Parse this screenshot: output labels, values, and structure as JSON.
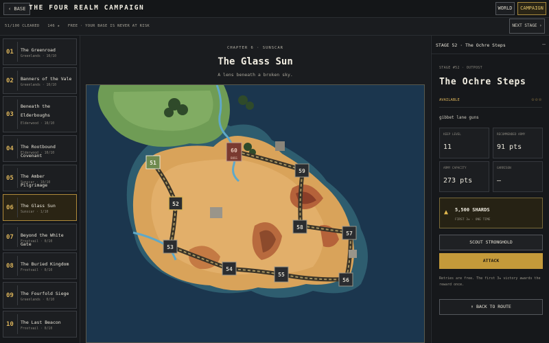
{
  "header": {
    "back_label": "‹ BASE",
    "title": "THE FOUR REALM CAMPAIGN",
    "world_label": "WORLD",
    "campaign_label": "CAMPAIGN"
  },
  "status": {
    "cleared": "51/100 CLEARED",
    "stars": "146 ★",
    "note": "FREE · YOUR BASE IS NEVER AT RISK",
    "next_label": "NEXT STAGE ›"
  },
  "stages": [
    {
      "num": "01",
      "name": "The Greenroad",
      "meta": "Greenlands · 10/10"
    },
    {
      "num": "02",
      "name": "Banners of the Vale",
      "meta": "Greenlands · 10/10"
    },
    {
      "num": "03",
      "name": "Beneath the Elderboughs",
      "meta": "Elderwood · 10/10"
    },
    {
      "num": "04",
      "name": "The Rootbound Covenant",
      "meta": "Elderwood · 10/10"
    },
    {
      "num": "05",
      "name": "The Amber Pilgrimage",
      "meta": "Sunscar · 10/10"
    },
    {
      "num": "06",
      "name": "The Glass Sun",
      "meta": "Sunscar · 1/10"
    },
    {
      "num": "07",
      "name": "Beyond the White Gate",
      "meta": "Frostvail · 0/10"
    },
    {
      "num": "08",
      "name": "The Buried Kingdom",
      "meta": "Frostvail · 0/10"
    },
    {
      "num": "09",
      "name": "The Fourfold Siege",
      "meta": "Greenlands · 0/10"
    },
    {
      "num": "10",
      "name": "The Last Beacon",
      "meta": "Frostvail · 0/10"
    }
  ],
  "center": {
    "chapter": "CHAPTER 6 · SUNSCAR",
    "title": "The Glass Sun",
    "subtitle": "A lens beneath a broken sky."
  },
  "map": {
    "nodes": [
      "51",
      "52",
      "53",
      "54",
      "55",
      "56",
      "57",
      "58",
      "59",
      "60"
    ],
    "boss_label": "BOSS"
  },
  "panel": {
    "header_title": "STAGE 52 · The Ochre Steps",
    "close_label": "—",
    "kicker": "STAGE #52 · OUTPOST",
    "name": "The Ochre Steps",
    "availability": "AVAILABLE",
    "stars": "☆☆☆",
    "enemy": "gibbet lane guns",
    "stats": [
      {
        "label": "KEEP LEVEL",
        "value": "11"
      },
      {
        "label": "RECOMMENDED ARMY",
        "value": "91 pts"
      },
      {
        "label": "ARMY CAPACITY",
        "value": "273 pts"
      },
      {
        "label": "GARRISON",
        "value": "–"
      }
    ],
    "reward": {
      "icon": "shard-icon",
      "amount": "5,500 SHARDS",
      "sub": "FIRST 3★ · ONE TIME"
    },
    "scout_label": "SCOUT STRONGHOLD",
    "attack_label": "ATTACK",
    "note": "Retries are free. The first 3★ victory awards the reward once.",
    "back_label": "↑ BACK TO ROUTE"
  },
  "colors": {
    "accent": "#c49a3a",
    "sea": "#1d3a52",
    "sand": "#d9a35a",
    "grass": "#6e9a52"
  }
}
